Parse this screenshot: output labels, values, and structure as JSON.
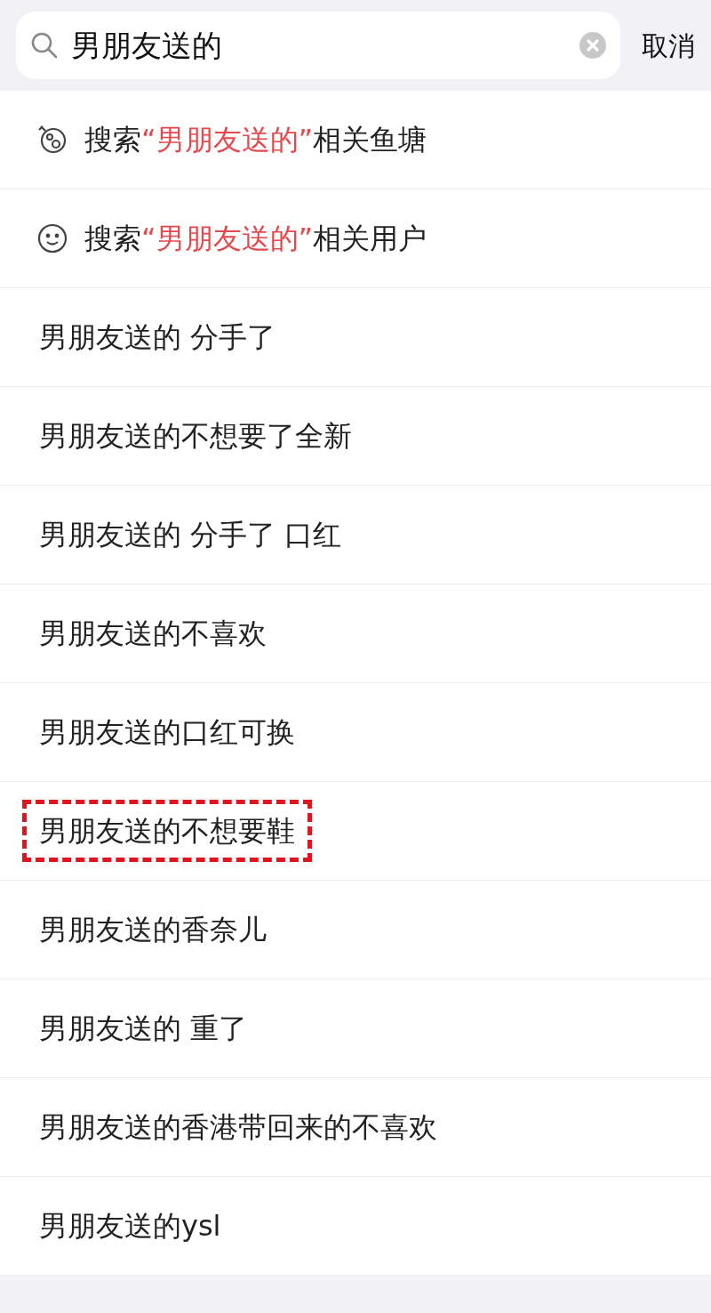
{
  "search": {
    "value": "男朋友送的",
    "cancel": "取消"
  },
  "rows": [
    {
      "kind": "pond",
      "prefix": "搜索",
      "query": "“男朋友送的”",
      "suffix": "相关鱼塘",
      "highlighted": false
    },
    {
      "kind": "user",
      "prefix": "搜索",
      "query": "“男朋友送的”",
      "suffix": "相关用户",
      "highlighted": false
    },
    {
      "kind": "suggestion",
      "text": "男朋友送的 分手了",
      "highlighted": false
    },
    {
      "kind": "suggestion",
      "text": "男朋友送的不想要了全新",
      "highlighted": false
    },
    {
      "kind": "suggestion",
      "text": "男朋友送的 分手了 口红",
      "highlighted": false
    },
    {
      "kind": "suggestion",
      "text": "男朋友送的不喜欢",
      "highlighted": false
    },
    {
      "kind": "suggestion",
      "text": "男朋友送的口红可换",
      "highlighted": false
    },
    {
      "kind": "suggestion",
      "text": "男朋友送的不想要鞋",
      "highlighted": true
    },
    {
      "kind": "suggestion",
      "text": "男朋友送的香奈儿",
      "highlighted": false
    },
    {
      "kind": "suggestion",
      "text": "男朋友送的 重了",
      "highlighted": false
    },
    {
      "kind": "suggestion",
      "text": "男朋友送的香港带回来的不喜欢",
      "highlighted": false
    },
    {
      "kind": "suggestion",
      "text": "男朋友送的ysl",
      "highlighted": false
    }
  ]
}
